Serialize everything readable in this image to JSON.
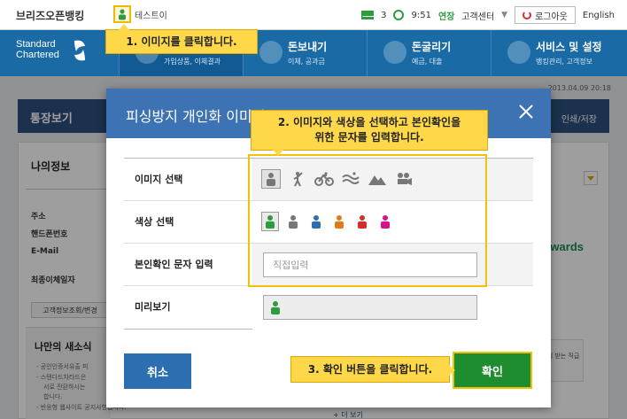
{
  "topbar": {
    "brand": "브리즈오픈뱅킹",
    "user_name": "테스트이",
    "mail_count": "3",
    "time": "9:51",
    "extend_label": "연장",
    "customer_center": "고객센터",
    "logout_label": "로그아웃",
    "language": "English"
  },
  "nav": {
    "logo_line1": "Standard",
    "logo_line2": "Chartered",
    "items": [
      {
        "title": "",
        "sub": "가입상품, 이체결과"
      },
      {
        "title": "돈보내기",
        "sub": "이체, 공과금"
      },
      {
        "title": "돈굴리기",
        "sub": "예금, 대출"
      },
      {
        "title": "서비스 및 설정",
        "sub": "뱅킹관리, 고객정보"
      }
    ]
  },
  "page": {
    "date": "2013.04.09 20:18",
    "title": "통장보기",
    "print_label": "인쇄/저장",
    "info_title": "나의정보",
    "info_labels": [
      "주소",
      "핸드폰번호",
      "E-Mail",
      "최종이체일자"
    ],
    "change_button": "고객정보조회/변경",
    "news_title": "나만의 새소식",
    "news_lines": [
      "- 공인인증서유출 피",
      "- 스탠다드차타드은",
      "서로 전환하시는",
      "합니다.",
      "- 반응형 웹사이트 공지사항입니다."
    ],
    "rewards": "wards",
    "promo_text": "계 받는 직급",
    "more_link": "+ 더 보기"
  },
  "modal": {
    "title": "피싱방지 개인화 이미지",
    "rows": {
      "image_label": "이미지 선택",
      "color_label": "색상 선택",
      "text_label": "본인확인 문자 입력",
      "preview_label": "미리보기"
    },
    "text_input": {
      "value": "",
      "placeholder": "직접입력"
    },
    "image_options": [
      "person-icon",
      "golfer-icon",
      "bicycle-icon",
      "waves-icon",
      "mountain-icon",
      "camera-icon"
    ],
    "color_options": [
      "#2e9b3e",
      "#777777",
      "#2b6fb0",
      "#e07b1a",
      "#d0312d",
      "#d4148e"
    ],
    "selected_color": "#2e9b3e",
    "cancel_label": "취소",
    "ok_label": "확인"
  },
  "tooltips": {
    "step1": "1. 이미지를 클릭합니다.",
    "step2_line1": "2. 이미지와 색상을 선택하고 본인확인을",
    "step2_line2": "위한 문자를 입력합니다.",
    "step3": "3. 확인 버튼을 클릭합니다."
  },
  "colors": {
    "nav_blue": "#1a6aa5",
    "modal_header": "#3d73b3",
    "ok_green": "#1e8d2f",
    "tooltip_yellow": "#ffd84a"
  }
}
